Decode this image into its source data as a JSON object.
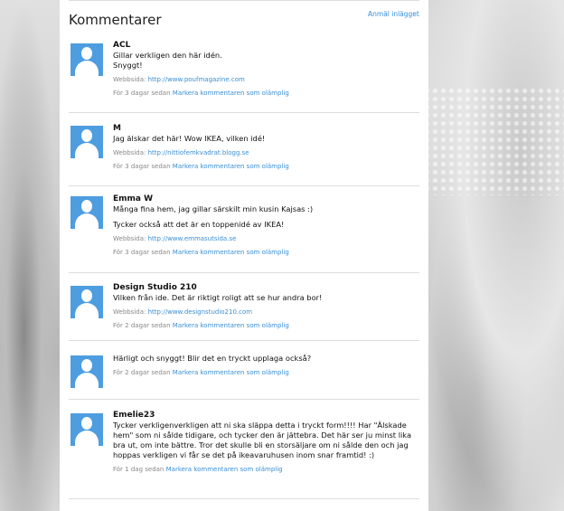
{
  "heading": "Kommentarer",
  "report_link": "Anmäl inlägget",
  "website_label": "Webbsida:",
  "flag_label": "Markera kommentaren som olämplig",
  "comments": [
    {
      "author": "ACL",
      "paragraphs": [
        "Gillar verkligen den här idén.",
        "Snyggt!"
      ],
      "website": "http://www.poufmagazine.com",
      "time": "För 3 dagar sedan"
    },
    {
      "author": "M",
      "paragraphs": [
        "Jag älskar det här! Wow IKEA, vilken idé!"
      ],
      "website": "http://nittiofemkvadrat.blogg.se",
      "time": "För 3 dagar sedan"
    },
    {
      "author": "Emma W",
      "paragraphs": [
        "Många fina hem, jag gillar särskilt min kusin Kajsas :)",
        "Tycker också att det är en toppenidé av IKEA!"
      ],
      "website": "http://www.emmasutsida.se",
      "time": "För 3 dagar sedan"
    },
    {
      "author": "Design Studio 210",
      "paragraphs": [
        "Vilken från ide. Det är riktigt roligt att se hur andra bor!"
      ],
      "website": "http://www.designstudio210.com",
      "time": "För 2 dagar sedan"
    },
    {
      "author": "",
      "paragraphs": [
        "Härligt och snyggt! Blir det en tryckt upplaga också?"
      ],
      "website": "",
      "time": "För 2 dagar sedan"
    },
    {
      "author": "Emelie23",
      "paragraphs": [
        "Tycker verkligenverkligen att ni ska släppa detta i tryckt form!!!! Har \"Älskade hem\" som ni sålde tidigare, och tycker den är jättebra. Det här ser ju minst lika bra ut, om inte bättre. Tror det skulle bli en storsäljare om ni sålde den och jag hoppas verkligen vi får se det på ikeavaruhusen inom snar framtid! :)"
      ],
      "website": "",
      "time": "För 1 dag sedan"
    }
  ]
}
